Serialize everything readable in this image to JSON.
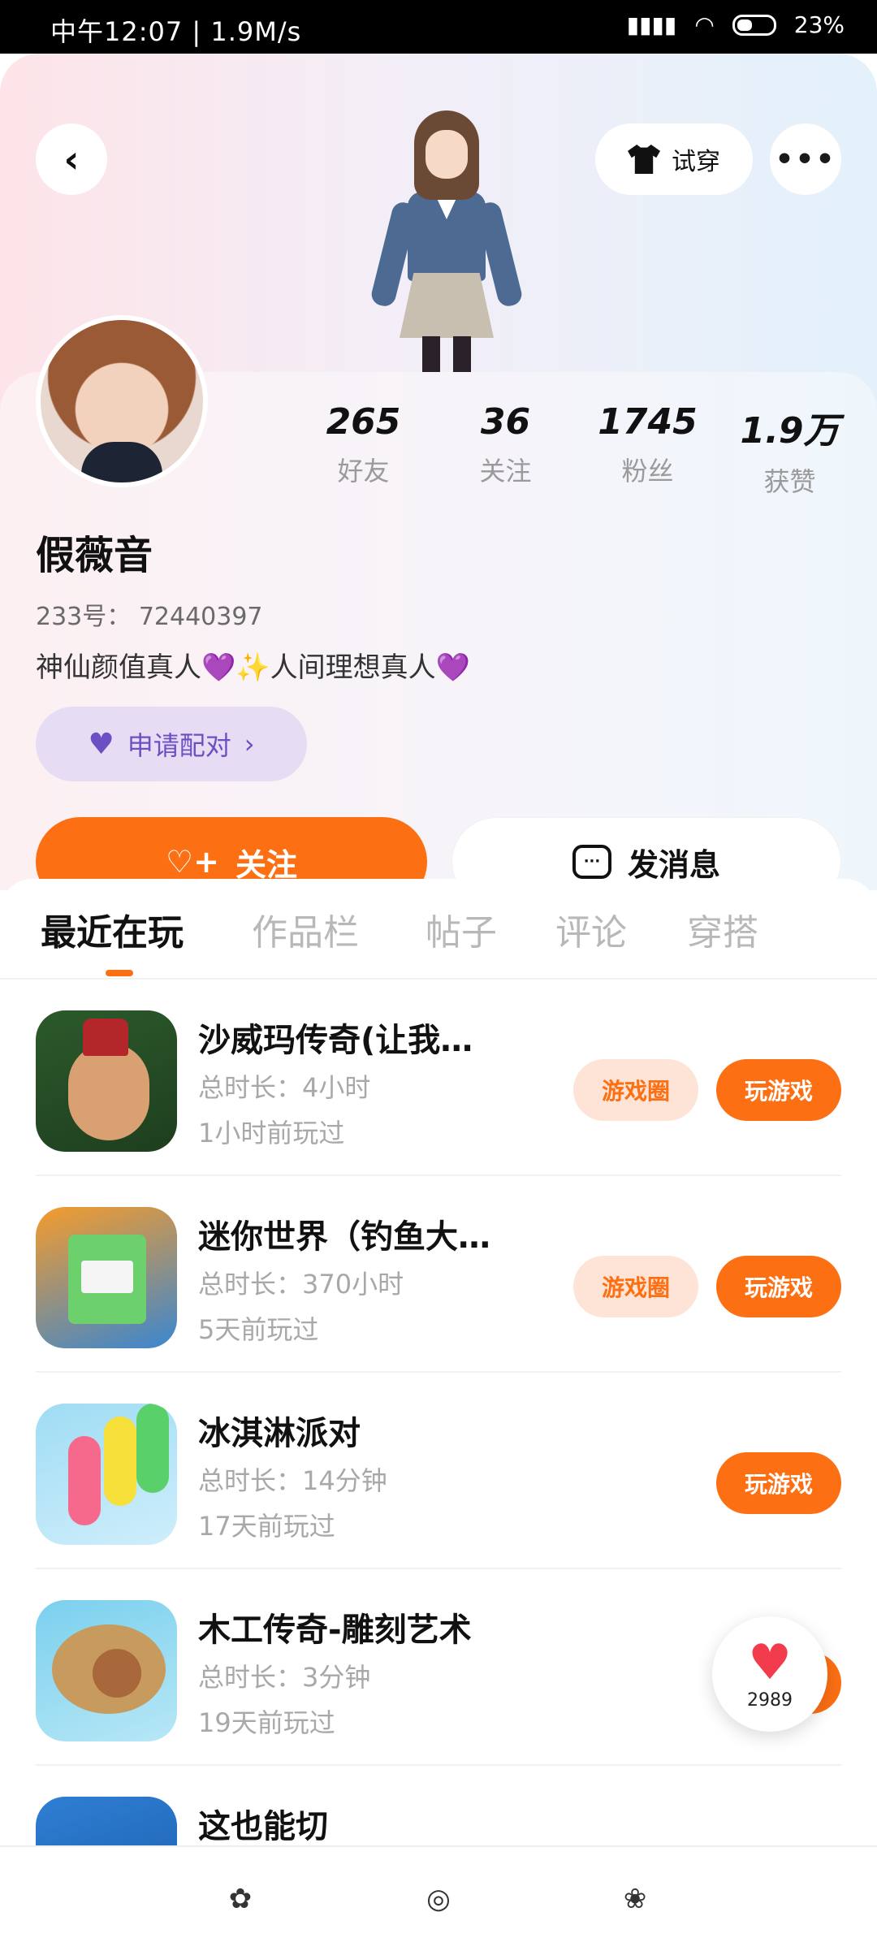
{
  "status_bar": {
    "left_text": "中午12:07 | 1.9M/s",
    "battery": "23%"
  },
  "header": {
    "tryon_label": "试穿"
  },
  "profile": {
    "stats": [
      {
        "value": "265",
        "label": "好友"
      },
      {
        "value": "36",
        "label": "关注"
      },
      {
        "value": "1745",
        "label": "粉丝"
      },
      {
        "value": "1.9万",
        "label": "获赞"
      }
    ],
    "name": "假薇音",
    "uid_label": "233号：",
    "uid": "72440397",
    "bio": "神仙颜值真人💜✨人间理想真人💜",
    "pair_label": "申请配对",
    "follow_label": "关注",
    "message_label": "发消息"
  },
  "tabs": [
    "最近在玩",
    "作品栏",
    "帖子",
    "评论",
    "穿搭"
  ],
  "games": [
    {
      "title": "沙威玛传奇(让我…",
      "duration": "总时长：4小时",
      "last_played": "1小时前玩过",
      "circle_label": "游戏圈",
      "play_label": "玩游戏",
      "icon": "shawarma-icon"
    },
    {
      "title": "迷你世界（钓鱼大…",
      "duration": "总时长：370小时",
      "last_played": "5天前玩过",
      "circle_label": "游戏圈",
      "play_label": "玩游戏",
      "icon": "mini-world-icon"
    },
    {
      "title": "冰淇淋派对",
      "duration": "总时长：14分钟",
      "last_played": "17天前玩过",
      "play_label": "玩游戏",
      "icon": "ice-cream-icon"
    },
    {
      "title": "木工传奇-雕刻艺术",
      "duration": "总时长：3分钟",
      "last_played": "19天前玩过",
      "icon": "woodwork-icon"
    },
    {
      "title": "这也能切",
      "icon": "cut-game-icon"
    }
  ],
  "like_count": "2989",
  "colors": {
    "accent": "#fd6f13",
    "pair_purple": "#6d4fc4"
  }
}
